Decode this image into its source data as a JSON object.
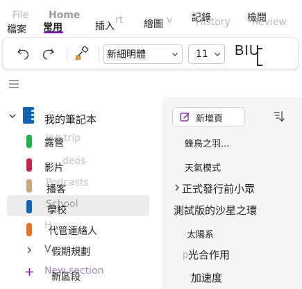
{
  "tabs": {
    "file": "檔案",
    "home": "常用",
    "insert": "插入",
    "draw": "繪圖",
    "history": "記錄",
    "review": "檢閱",
    "ghost_file": "File",
    "ghost_home": "Home",
    "ghost_insert": "rt",
    "ghost_draw": "v",
    "ghost_history": "History",
    "ghost_review": "Review"
  },
  "toolbar": {
    "font_name": "新細明體",
    "font_size": "11",
    "biu": "BIU"
  },
  "notebook": {
    "name": "我的筆記本",
    "sections": [
      {
        "label": "露營",
        "ghost": "ing trip",
        "color": "#21b04b"
      },
      {
        "label": "影片",
        "ghost": "deos",
        "color": "#c4264e"
      },
      {
        "label": "播客",
        "ghost": "Podcasts",
        "color": "#c7a77e"
      },
      {
        "label": "學校",
        "ghost": "School",
        "color": "#0f64b0",
        "selected": true
      },
      {
        "label": "代管連絡人",
        "ghost": "H",
        "color": "#e8732a"
      }
    ],
    "group": {
      "label": "假期規劃",
      "ghost": "Vacation",
      "prefix": "V"
    },
    "new_section": {
      "label": "新區段",
      "ghost": "New section"
    }
  },
  "pages_panel": {
    "new_page_label": "新增頁",
    "pages": [
      {
        "label": "蜂鳥之羽..."
      },
      {
        "label": "天氣模式"
      },
      {
        "label": "正式發行前小眾",
        "expanded": true
      },
      {
        "label": "測試版的沙星之環"
      },
      {
        "label": "太陽系"
      },
      {
        "label": "光合作用",
        "prefix": "p"
      },
      {
        "label": "加速度"
      }
    ]
  },
  "colors": {
    "accent": "#7719aa",
    "notebook_icon": "#0f64b0",
    "selected_row": "#ececec",
    "pages_bg": "#f5f5f5"
  },
  "icons": {
    "undo": "undo-icon",
    "redo": "redo-icon",
    "format_painter": "format-painter-icon",
    "hamburger": "hamburger-icon",
    "notebook": "notebook-icon",
    "new_page": "new-page-icon",
    "sort": "sort-icon"
  }
}
